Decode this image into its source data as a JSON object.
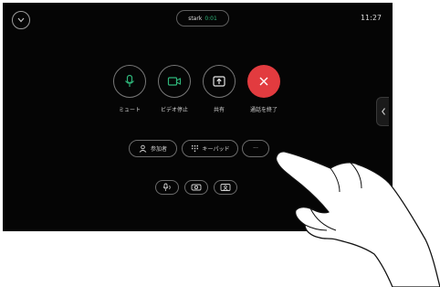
{
  "status": {
    "name": "stark",
    "timer": "0:01",
    "name_color": "#e0e0e0",
    "timer_color": "#2fb67a"
  },
  "clock": "11:27",
  "controls": [
    {
      "label": "ミュート",
      "icon": "microphone-icon"
    },
    {
      "label": "ビデオ停止",
      "icon": "camera-icon"
    },
    {
      "label": "共有",
      "icon": "share-screen-icon"
    },
    {
      "label": "通話を終了",
      "icon": "close-icon",
      "color": "#e23b3f"
    }
  ],
  "pills": [
    {
      "label": "参加者",
      "icon": "participants-icon"
    },
    {
      "label": "キーパッド",
      "icon": "keypad-icon"
    },
    {
      "label": "···",
      "icon": "more-icon"
    }
  ],
  "small_buttons": [
    {
      "icon": "mic-settings-icon"
    },
    {
      "icon": "camera-settings-icon"
    },
    {
      "icon": "self-view-icon"
    }
  ],
  "side_handle_icon": "chevron-left-icon",
  "top_left_icon": "chevron-down-icon"
}
